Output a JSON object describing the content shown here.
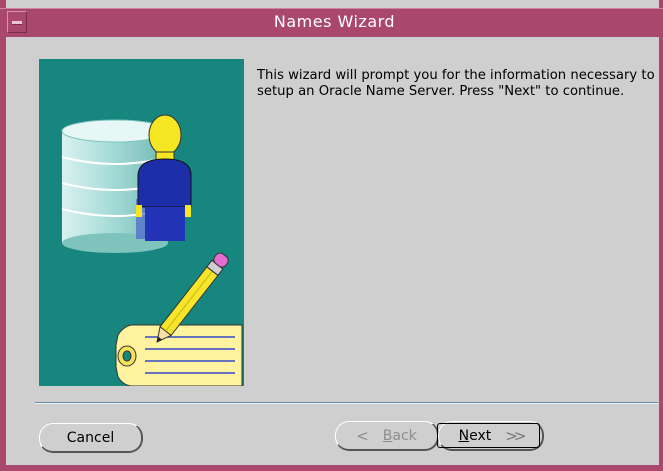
{
  "window": {
    "title": "Names Wizard"
  },
  "intro": {
    "text": "This wizard will prompt you for the information necessary to setup an Oracle Name Server. Press \"Next\" to continue."
  },
  "buttons": {
    "cancel": "Cancel",
    "back": "Back",
    "next": "Next"
  },
  "icons": {
    "back": "chevron-left-icon",
    "next": "chevron-right-icon",
    "window_menu": "window-menu-icon"
  },
  "colors": {
    "titlebar": "#a9486c",
    "illustration_bg": "#16867f"
  }
}
